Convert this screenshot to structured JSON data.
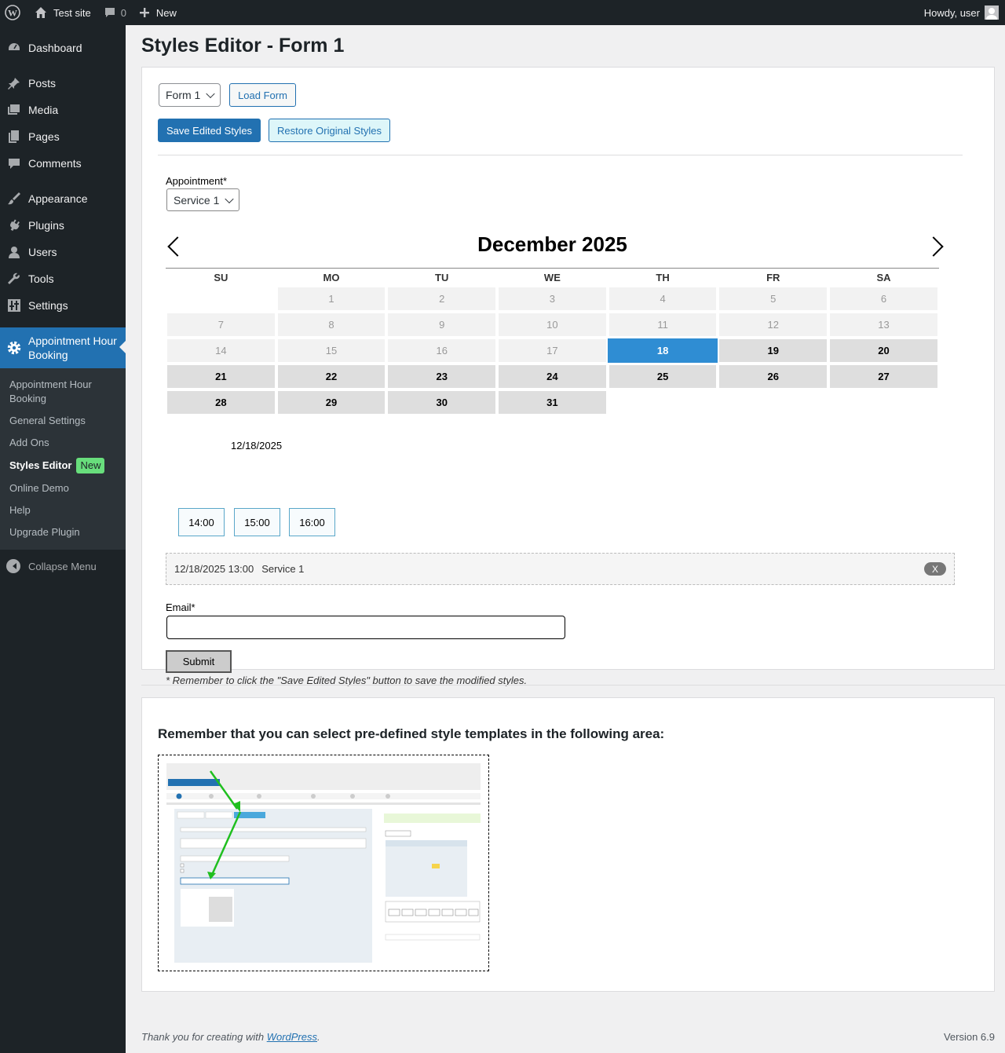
{
  "adminbar": {
    "site_name": "Test site",
    "comments_count": "0",
    "new_label": "New",
    "howdy": "Howdy, user"
  },
  "sidebar": {
    "items": [
      {
        "label": "Dashboard",
        "icon": "dashboard-icon"
      },
      {
        "label": "Posts",
        "icon": "pin-icon"
      },
      {
        "label": "Media",
        "icon": "media-icon"
      },
      {
        "label": "Pages",
        "icon": "pages-icon"
      },
      {
        "label": "Comments",
        "icon": "comment-icon"
      },
      {
        "label": "Appearance",
        "icon": "brush-icon"
      },
      {
        "label": "Plugins",
        "icon": "plug-icon"
      },
      {
        "label": "Users",
        "icon": "user-icon"
      },
      {
        "label": "Tools",
        "icon": "wrench-icon"
      },
      {
        "label": "Settings",
        "icon": "settings-icon"
      }
    ],
    "current": {
      "label": "Appointment Hour Booking",
      "icon": "gear-icon"
    },
    "submenu": [
      "Appointment Hour Booking",
      "General Settings",
      "Add Ons",
      "Styles Editor",
      "Online Demo",
      "Help",
      "Upgrade Plugin"
    ],
    "new_badge": "New",
    "collapse": "Collapse Menu"
  },
  "page": {
    "title": "Styles Editor - Form 1",
    "form_select": "Form 1",
    "load_form": "Load Form",
    "save_styles": "Save Edited Styles",
    "restore_styles": "Restore Original Styles"
  },
  "form": {
    "appointment_label": "Appointment*",
    "service_select": "Service 1",
    "calendar_title": "December 2025",
    "weekdays": [
      "SU",
      "MO",
      "TU",
      "WE",
      "TH",
      "FR",
      "SA"
    ],
    "weeks": [
      [
        {
          "d": "",
          "s": "blank"
        },
        {
          "d": "1",
          "s": "disabled"
        },
        {
          "d": "2",
          "s": "disabled"
        },
        {
          "d": "3",
          "s": "disabled"
        },
        {
          "d": "4",
          "s": "disabled"
        },
        {
          "d": "5",
          "s": "disabled"
        },
        {
          "d": "6",
          "s": "disabled"
        }
      ],
      [
        {
          "d": "7",
          "s": "disabled"
        },
        {
          "d": "8",
          "s": "disabled"
        },
        {
          "d": "9",
          "s": "disabled"
        },
        {
          "d": "10",
          "s": "disabled"
        },
        {
          "d": "11",
          "s": "disabled"
        },
        {
          "d": "12",
          "s": "disabled"
        },
        {
          "d": "13",
          "s": "disabled"
        }
      ],
      [
        {
          "d": "14",
          "s": "disabled"
        },
        {
          "d": "15",
          "s": "disabled"
        },
        {
          "d": "16",
          "s": "disabled"
        },
        {
          "d": "17",
          "s": "disabled"
        },
        {
          "d": "18",
          "s": "selected"
        },
        {
          "d": "19",
          "s": "avail"
        },
        {
          "d": "20",
          "s": "avail"
        }
      ],
      [
        {
          "d": "21",
          "s": "avail"
        },
        {
          "d": "22",
          "s": "avail"
        },
        {
          "d": "23",
          "s": "avail"
        },
        {
          "d": "24",
          "s": "avail"
        },
        {
          "d": "25",
          "s": "avail"
        },
        {
          "d": "26",
          "s": "avail"
        },
        {
          "d": "27",
          "s": "avail"
        }
      ],
      [
        {
          "d": "28",
          "s": "avail"
        },
        {
          "d": "29",
          "s": "avail"
        },
        {
          "d": "30",
          "s": "avail"
        },
        {
          "d": "31",
          "s": "avail"
        },
        {
          "d": "",
          "s": "blank"
        },
        {
          "d": "",
          "s": "blank"
        },
        {
          "d": "",
          "s": "blank"
        }
      ]
    ],
    "selected_date": "12/18/2025",
    "slots": [
      "14:00",
      "15:00",
      "16:00"
    ],
    "selection_text": "12/18/2025 13:00",
    "selection_service": "Service 1",
    "remove_label": "X",
    "email_label": "Email*",
    "submit_label": "Submit",
    "note": "* Remember to click the \"Save Edited Styles\" button to save the modified styles."
  },
  "templates": {
    "heading": "Remember that you can select pre-defined style templates in the following area:"
  },
  "footer": {
    "thanks_prefix": "Thank you for creating with ",
    "wp_link": "WordPress",
    "thanks_suffix": ".",
    "version": "Version 6.9"
  }
}
